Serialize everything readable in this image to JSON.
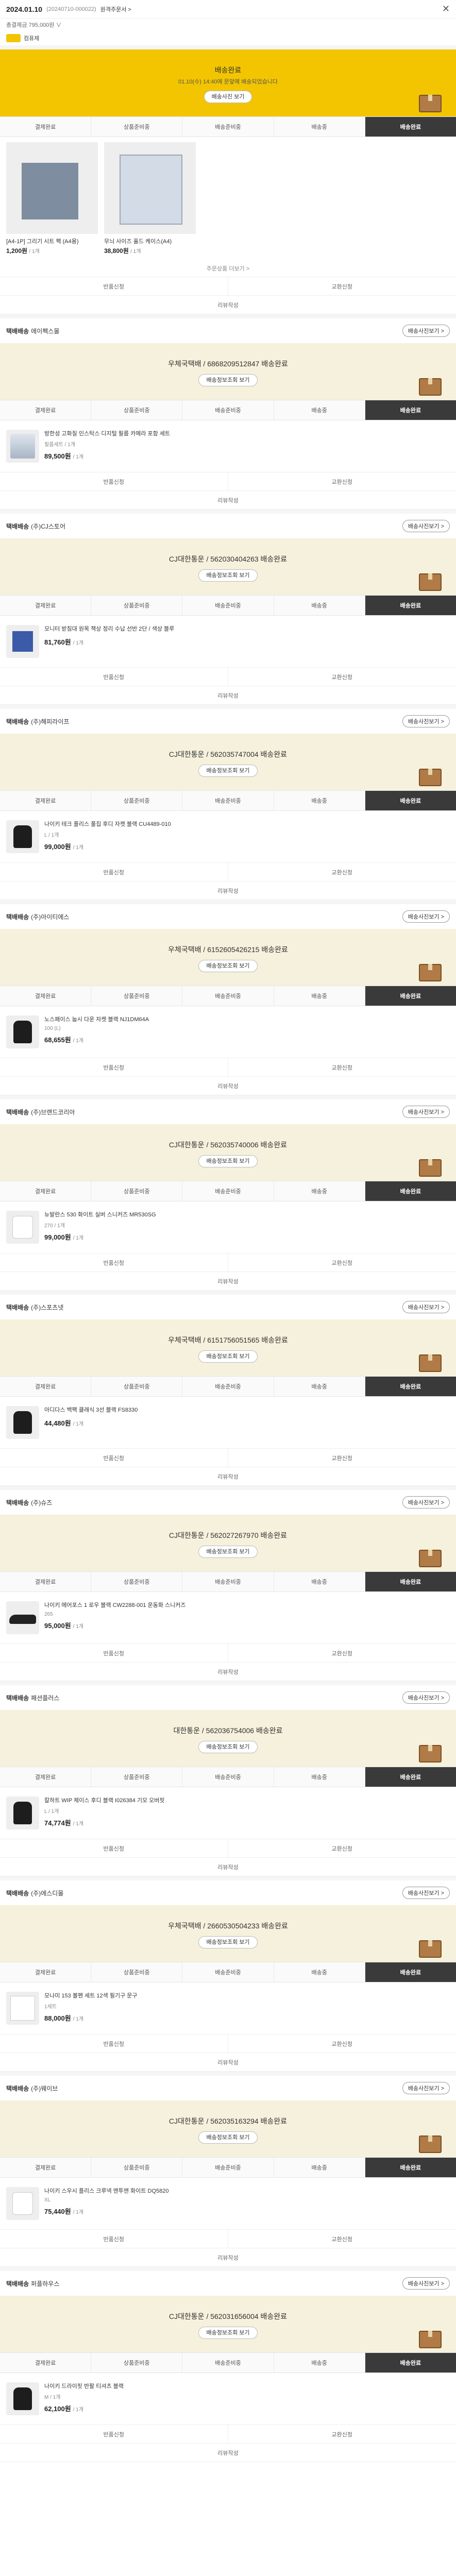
{
  "header": {
    "date": "2024.01.10",
    "order_no": "(20240710-000022)",
    "detail_link": "원격주문서 >",
    "close": "✕",
    "sub": "총결제금 795,000원 ∨",
    "shop": "컴퓨제"
  },
  "labels": {
    "delivery": "배송",
    "tracking_btn": "배송정보조회 보기",
    "exchange": "반품신청",
    "refund": "교환신청",
    "review": "리뷰작성",
    "check": "배송사진보기 >",
    "more": "주문상품 더보기 >",
    "currency_note": "/ 1개"
  },
  "steps": [
    "결제완료",
    "상품준비중",
    "배송준비중",
    "배송중",
    "배송완료"
  ],
  "first_pkg": {
    "carrier": "배송완료",
    "sub": "01.10(수) 14:40에 문앞에 배송되었습니다",
    "button": "배송사진 보기",
    "items": [
      {
        "name": "[A4-1P] 그리기 시트 팩 (A4용)",
        "price": "1,200원",
        "unit": "/ 1개"
      },
      {
        "name": "무늬 사이즈 홀드 케이스(A4)",
        "price": "38,800원",
        "unit": "/ 1개"
      }
    ]
  },
  "packages": [
    {
      "title": "택배배송",
      "shop": "에이펙스몰",
      "carrier": "우체국택배 / 6868209512847 배송완료",
      "thumb": "photo",
      "name": "방한성 고화질 인스탁스 디지털 필름 카메라 포함 세트",
      "option": "필름세트 / 1개",
      "price": "89,500원"
    },
    {
      "title": "택배배송",
      "shop": "(주)CJ스토어",
      "carrier": "CJ대한통운 / 562030404263 배송완료",
      "thumb": "blue",
      "name": "모니터 받침대 원목 책상 정리 수납 선반 2단 / 색상 블루",
      "option": "",
      "price": "81,760원"
    },
    {
      "title": "택배배송",
      "shop": "(주)해피라이프",
      "carrier": "CJ대한통운 / 562035747004 배송완료",
      "thumb": "dark",
      "name": "나이키 테크 플리스 풀집 후디 자켓 블랙 CU4489-010",
      "option": "L / 1개",
      "price": "99,000원"
    },
    {
      "title": "택배배송",
      "shop": "(주)아이티에스",
      "carrier": "우체국택배 / 6152605426215 배송완료",
      "thumb": "dark",
      "name": "노스페이스 눕시 다운 자켓 블랙 NJ1DM64A",
      "option": "100 (L)",
      "price": "68,655원"
    },
    {
      "title": "택배배송",
      "shop": "(주)브랜드코리아",
      "carrier": "CJ대한통운 / 562035740006 배송완료",
      "thumb": "white",
      "name": "뉴발란스 530 화이트 실버 스니커즈 MR530SG",
      "option": "270 / 1개",
      "price": "99,000원"
    },
    {
      "title": "택배배송",
      "shop": "(주)스포츠넷",
      "carrier": "우체국택배 / 6151756051565 배송완료",
      "thumb": "dark",
      "name": "아디다스 백팩 클래식 3선 블랙 FS8330",
      "option": "",
      "price": "44,480원"
    },
    {
      "title": "택배배송",
      "shop": "(주)슈즈",
      "carrier": "CJ대한통운 / 562027267970 배송완료",
      "thumb": "shoe",
      "name": "나이키 에어포스 1 로우 블랙 CW2288-001 운동화 스니커즈",
      "option": "265",
      "price": "95,000원"
    },
    {
      "title": "택배배송",
      "shop": "패션플러스",
      "carrier": "대한통운 / 562036754006 배송완료",
      "thumb": "dark",
      "name": "칼하트 WIP 체이스 후디 블랙 I026384 기모 오버핏",
      "option": "L / 1개",
      "price": "74,774원"
    },
    {
      "title": "택배배송",
      "shop": "(주)에스디몰",
      "carrier": "우체국택배 / 2660530504233 배송완료",
      "thumb": "paper",
      "name": "모나미 153 볼펜 세트 12색 필기구 문구",
      "option": "1세트",
      "price": "88,000원"
    },
    {
      "title": "택배배송",
      "shop": "(주)웨이브",
      "carrier": "CJ대한통운 / 562035163294 배송완료",
      "thumb": "white",
      "name": "나이키 스우시 플리스 크루넥 맨투맨 화이트 DQ5820",
      "option": "XL",
      "price": "75,440원"
    },
    {
      "title": "택배배송",
      "shop": "퍼플하우스",
      "carrier": "CJ대한통운 / 562031656004 배송완료",
      "thumb": "dark",
      "name": "나이키 드라이핏 반팔 티셔츠 블랙",
      "option": "M / 1개",
      "price": "62,100원"
    }
  ]
}
